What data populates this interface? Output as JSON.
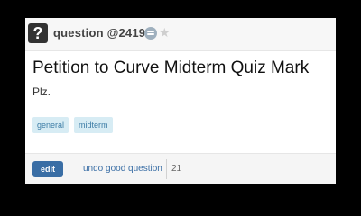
{
  "header": {
    "icon_glyph": "?",
    "title": "question @2419",
    "watch_icon": "eye-icon",
    "star_icon": "star-icon",
    "star_glyph": "★"
  },
  "post": {
    "title": "Petition to Curve Midterm Quiz Mark",
    "body": "Plz.",
    "tags": [
      "general",
      "midterm"
    ]
  },
  "footer": {
    "edit_label": "edit",
    "undo_label": "undo good question",
    "good_count": "21"
  },
  "colors": {
    "background": "#000000",
    "accent": "#3a6ea5",
    "tag_bg": "#d7ecf4"
  }
}
